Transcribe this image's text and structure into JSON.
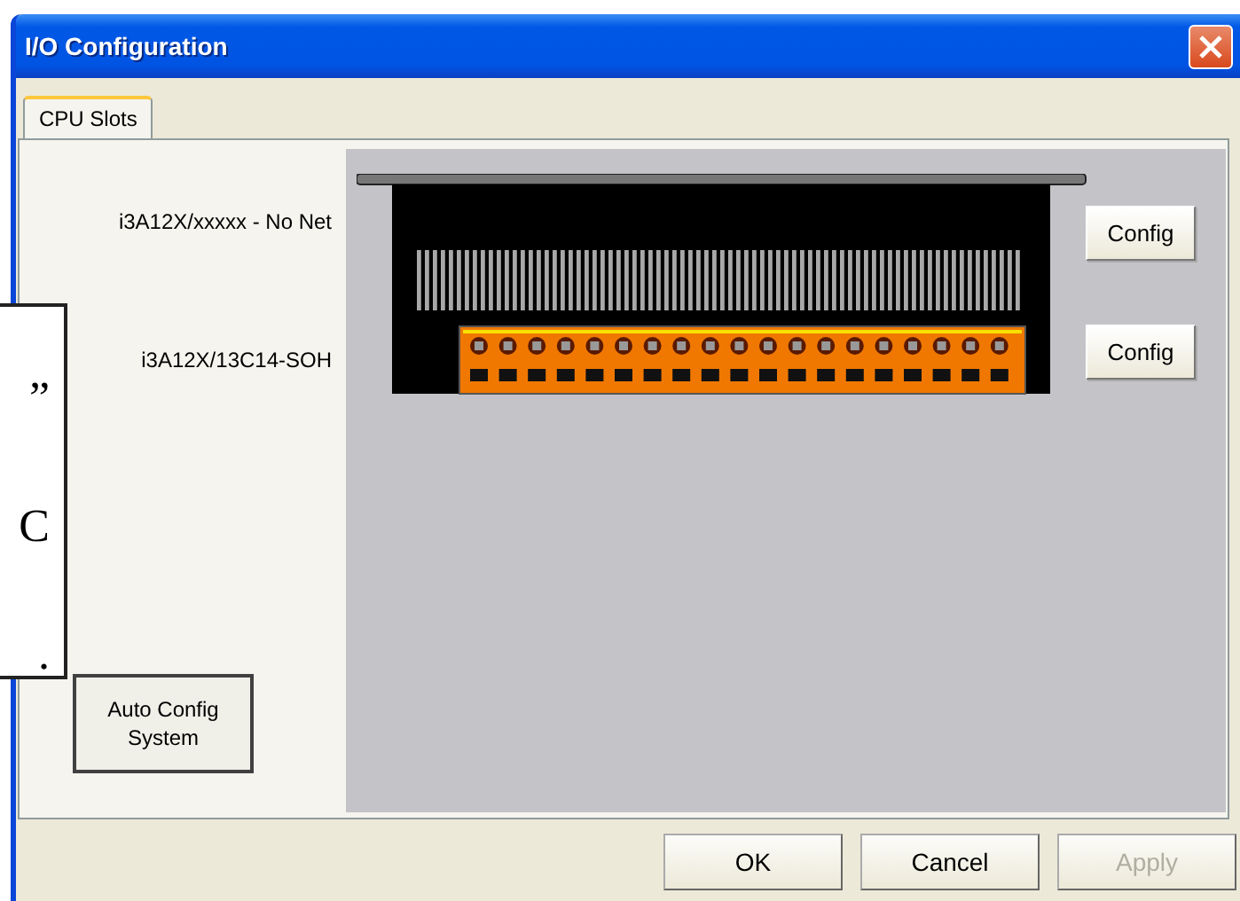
{
  "window": {
    "title": "I/O Configuration"
  },
  "tabs": [
    {
      "label": "CPU Slots",
      "selected": true
    }
  ],
  "slots": [
    {
      "label": "i3A12X/xxxxx - No Net",
      "button": "Config"
    },
    {
      "label": "i3A12X/13C14-SOH",
      "button": "Config"
    }
  ],
  "auto_config_button": "Auto Config\nSystem",
  "buttons": [
    {
      "label": "OK",
      "disabled": false
    },
    {
      "label": "Cancel",
      "disabled": false
    },
    {
      "label": "Apply",
      "disabled": true
    }
  ],
  "overlay_note": {
    "lines": [
      "”",
      "C",
      "."
    ]
  }
}
